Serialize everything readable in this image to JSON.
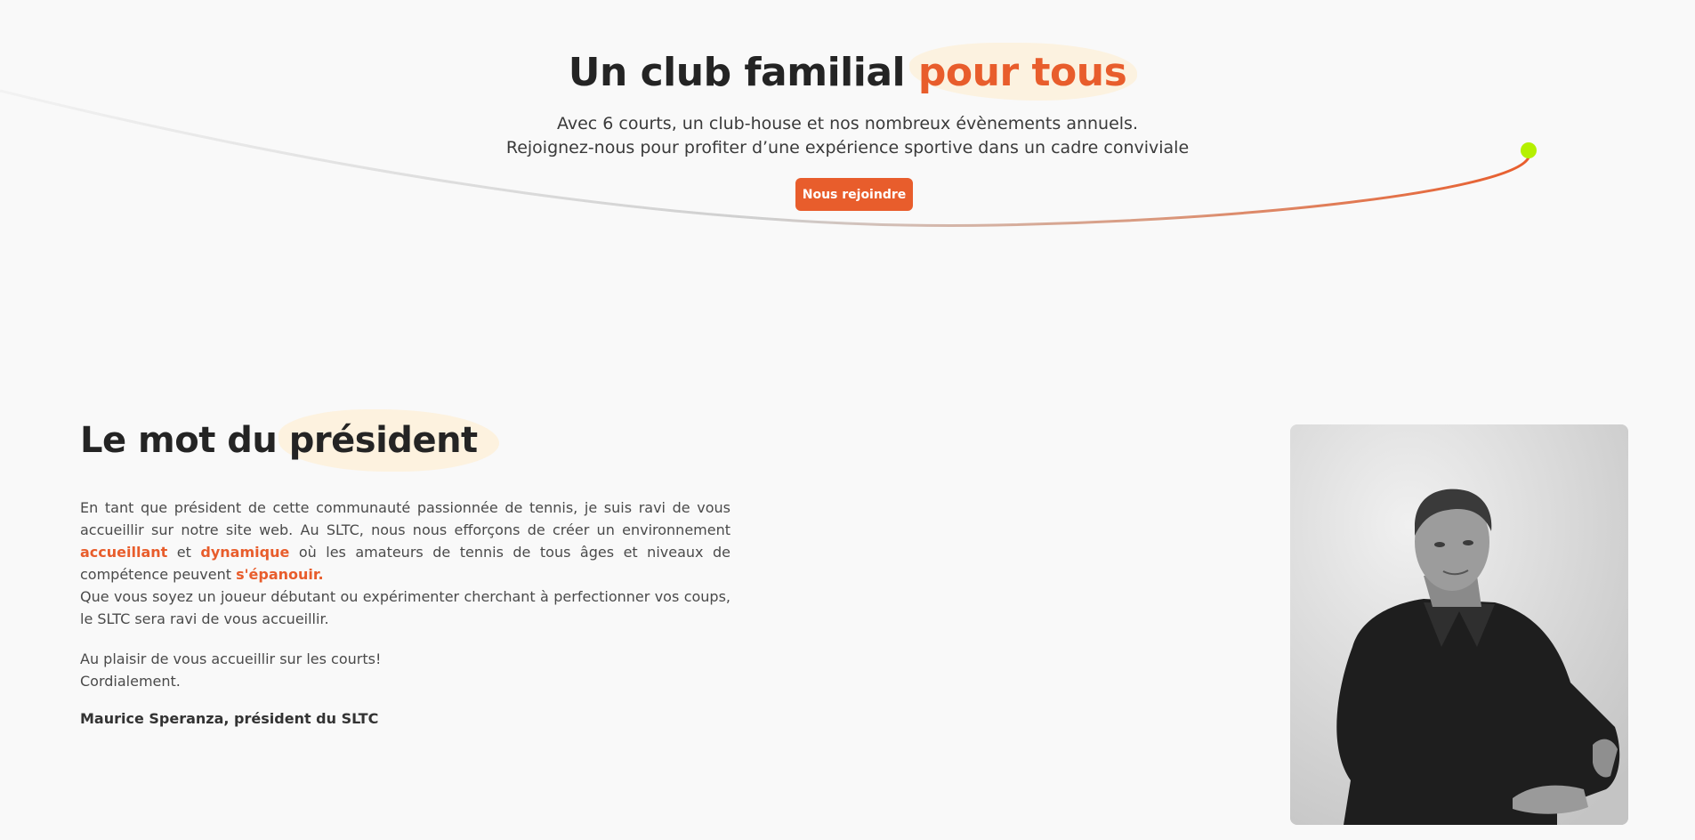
{
  "hero": {
    "title_main": "Un club familial ",
    "title_highlight": "pour tous",
    "subtitle_line1": "Avec 6 courts, un club-house et nos nombreux évènements annuels.",
    "subtitle_line2": "Rejoignez-nous pour profiter d’une expérience sportive dans un cadre conviviale",
    "cta_label": "Nous rejoindre"
  },
  "president": {
    "title_main": "Le mot du ",
    "title_highlight": "président",
    "p1_a": "En tant que président de cette communauté passionnée de tennis, je suis ravi de vous accueillir sur notre site web. Au SLTC, nous nous efforçons de créer un environnement ",
    "p1_accent1": "accueillant",
    "p1_b": " et ",
    "p1_accent2": "dynamique",
    "p1_c": " où les amateurs de tennis de tous âges et niveaux de compétence peuvent ",
    "p1_accent3": "s'épanouir",
    "p1_d": ".",
    "p2": "Que vous soyez un joueur débutant ou expérimenter cherchant à perfectionner vos coups, le SLTC sera ravi de vous accueillir.",
    "closing1": "Au plaisir de vous accueillir sur les courts!",
    "closing2": "Cordialement.",
    "signature": "Maurice Speranza, président du SLTC"
  },
  "colors": {
    "accent": "#e85d2c",
    "ball": "#b5f000",
    "highlight_blob": "#fdf1dc"
  }
}
